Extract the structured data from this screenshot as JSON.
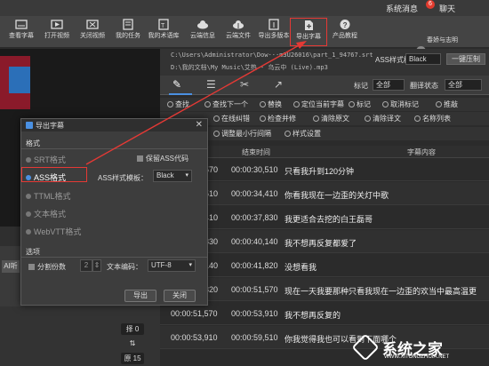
{
  "titlebar": {
    "system_msg": "系统消息",
    "badge": "6",
    "chat": "聊天"
  },
  "toolbar": {
    "items": [
      {
        "label": "查看字幕",
        "icon": "view-subtitle-icon"
      },
      {
        "label": "打开视频",
        "icon": "open-video-icon"
      },
      {
        "label": "关闭视频",
        "icon": "close-video-icon"
      },
      {
        "label": "我的任务",
        "icon": "my-tasks-icon"
      },
      {
        "label": "我的术语库",
        "icon": "term-library-icon"
      },
      {
        "label": "云端信息",
        "icon": "cloud-info-icon"
      },
      {
        "label": "云端文件",
        "icon": "cloud-file-icon"
      },
      {
        "label": "导出多版本",
        "icon": "export-multi-icon"
      },
      {
        "label": "导出字幕",
        "icon": "export-subtitle-icon"
      },
      {
        "label": "产品教程",
        "icon": "help-icon"
      }
    ],
    "highlight_color": "#e53935"
  },
  "user": {
    "name": "春娇与志明",
    "logout": "退出"
  },
  "paths": {
    "line1": "C:\\Users\\Administrator\\Dow···m3U26016\\part_1_94767.srt",
    "line2": "D:\\我的文档\\My Music\\艾热 - 乌云中 (Live).mp3"
  },
  "ass_template": {
    "label": "ASS样式模板",
    "value": "Black",
    "button": "一键压制"
  },
  "tabs": {
    "mark_label": "标记",
    "mark_value": "全部",
    "translate_label": "翻译状态",
    "translate_value": "全部"
  },
  "actions_row1": [
    "查找",
    "查找下一个",
    "替换",
    "定位当前字幕",
    "标记",
    "取消标记",
    "推敲"
  ],
  "actions_row2": [
    "在线纠错",
    "检查并修",
    "清除原文",
    "清除译文",
    "名称列表"
  ],
  "actions_row3": [
    "调整最小行间隔",
    "样式设置"
  ],
  "table": {
    "headers": {
      "end": "结束时间",
      "content": "字幕内容"
    },
    "rows": [
      {
        "start": "570",
        "end": "00:00:30,510",
        "content": "只看我升到120分钟"
      },
      {
        "start": "510",
        "end": "00:00:34,410",
        "content": "你看我现在一边歪的关灯中歌"
      },
      {
        "start": "410",
        "end": "00:00:37,830",
        "content": "我更适合去挖的白王磊哥"
      },
      {
        "start": "830",
        "end": "00:00:40,140",
        "content": "我不想再反复都爱了"
      },
      {
        "start": "140",
        "end": "00:00:41,820",
        "content": "没想看我"
      },
      {
        "start": "820",
        "end": "00:00:51,570",
        "content": "现在一天我要那种只看我现在一边歪的欢当中最高温更"
      },
      {
        "start": "00:00:51,570",
        "end": "00:00:53,910",
        "content": "我不想再反复的"
      },
      {
        "start": "00:00:53,910",
        "end": "00:00:59,510",
        "content": "你我觉得我也可以看到下面哪个"
      }
    ]
  },
  "left": {
    "ai_label": "AI听",
    "btn1": "择 0",
    "btn2": "原 15"
  },
  "dialog": {
    "title": "导出字幕",
    "format_label": "格式",
    "formats": [
      "SRT格式",
      "ASS格式",
      "TTML格式",
      "文本格式",
      "WebVTT格式"
    ],
    "keep_ass": "保留ASS代码",
    "ass_template_label": "ASS样式模板：",
    "ass_template_value": "Black",
    "options_label": "选项",
    "split_label": "分割份数",
    "split_value": "2",
    "encoding_label": "文本编码：",
    "encoding_value": "UTF-8",
    "export_button": "导出",
    "close_button": "关闭"
  },
  "watermark": {
    "title": "系统之家",
    "url": "WWW.XITONGZHIJIA.NET"
  }
}
